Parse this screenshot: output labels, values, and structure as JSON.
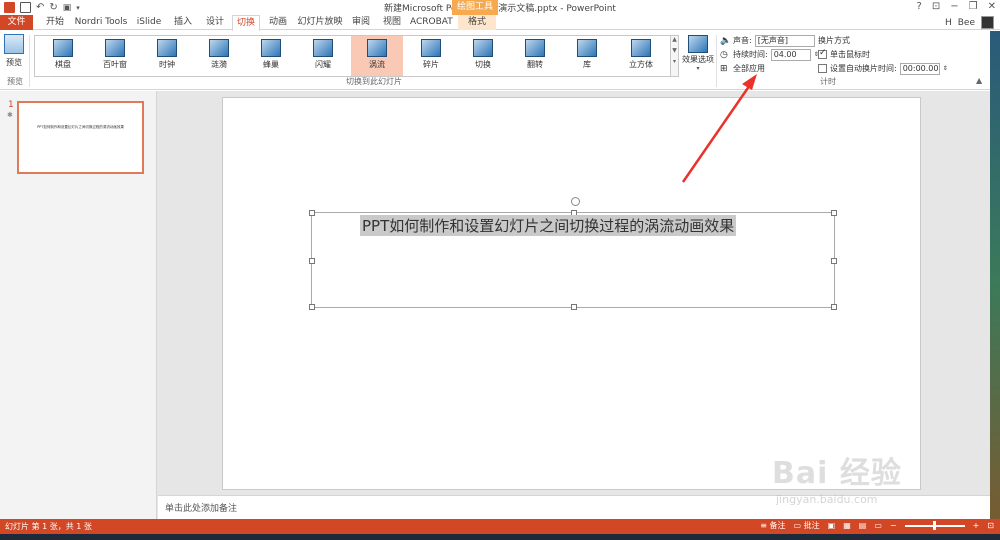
{
  "window": {
    "doc_title": "新建Microsoft PowerPoint 演示文稿.pptx - PowerPoint",
    "contextual_tools": "绘图工具",
    "help": "?",
    "min": "−",
    "restore": "❐",
    "close": "✕"
  },
  "tabs": [
    {
      "label": "文件"
    },
    {
      "label": "开始"
    },
    {
      "label": "Nordri Tools"
    },
    {
      "label": "iSlide"
    },
    {
      "label": "插入"
    },
    {
      "label": "设计"
    },
    {
      "label": "切换"
    },
    {
      "label": "动画"
    },
    {
      "label": "幻灯片放映"
    },
    {
      "label": "审阅"
    },
    {
      "label": "视图"
    },
    {
      "label": "ACROBAT"
    },
    {
      "label": "格式"
    }
  ],
  "user": {
    "name": "H",
    "name2": "Bee"
  },
  "ribbon": {
    "preview_label": "预览",
    "preview_group": "预览",
    "transitions_group": "切换到此幻灯片",
    "transitions": [
      {
        "label": "棋盘"
      },
      {
        "label": "百叶窗"
      },
      {
        "label": "时钟"
      },
      {
        "label": "涟漪"
      },
      {
        "label": "蜂巢"
      },
      {
        "label": "闪耀"
      },
      {
        "label": "涡流"
      },
      {
        "label": "碎片"
      },
      {
        "label": "切换"
      },
      {
        "label": "翻转"
      },
      {
        "label": "库"
      },
      {
        "label": "立方体"
      }
    ],
    "selected_transition": "涡流",
    "effect_options": "效果选项",
    "timing_group": "计时",
    "sound_label": "声音:",
    "sound_value": "[无声音]",
    "duration_label": "持续时间:",
    "duration_value": "04.00",
    "apply_all": "全部应用",
    "advance_title": "换片方式",
    "on_click": "单击鼠标时",
    "after_time": "设置自动换片时间:",
    "after_value": "00:00.00"
  },
  "slides": {
    "number": "1",
    "title": "PPT如何制作和设置幻灯片之间切换过程的涡流动画效果"
  },
  "notes_placeholder": "单击此处添加备注",
  "status": {
    "slide_info": "幻灯片 第 1 张，共 1 张",
    "notes_btn": "备注",
    "comments_btn": "批注"
  },
  "watermark": {
    "main": "Bai 经验",
    "sub": "jingyan.baidu.com"
  }
}
